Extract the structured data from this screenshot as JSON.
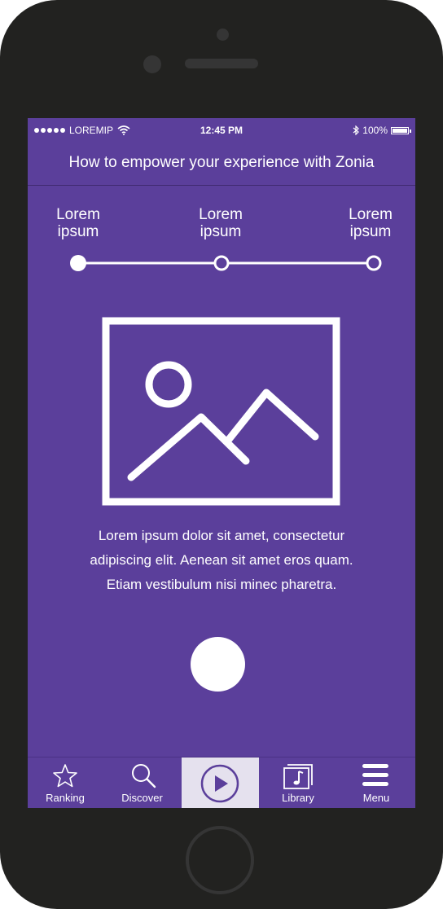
{
  "status_bar": {
    "carrier": "LOREMIP",
    "time": "12:45 PM",
    "battery": "100%"
  },
  "header": {
    "title": "How to empower your experience with Zonia"
  },
  "steps": [
    {
      "line1": "Lorem",
      "line2": "ipsum",
      "state": "active"
    },
    {
      "line1": "Lorem",
      "line2": "ipsum",
      "state": "inactive"
    },
    {
      "line1": "Lorem",
      "line2": "ipsum",
      "state": "inactive"
    }
  ],
  "illustration": {
    "icon": "image-placeholder-icon"
  },
  "content": {
    "line1": "Lorem ipsum dolor sit amet, consectetur",
    "line2": "adipiscing elit. Aenean sit amet eros quam.",
    "line3": "Etiam vestibulum nisi minec pharetra."
  },
  "tab_bar": {
    "tabs": [
      {
        "label": "Ranking",
        "icon": "star-icon"
      },
      {
        "label": "Discover",
        "icon": "search-icon"
      },
      {
        "label": "",
        "icon": "play-icon",
        "active": true
      },
      {
        "label": "Library",
        "icon": "music-library-icon"
      },
      {
        "label": "Menu",
        "icon": "hamburger-menu-icon"
      }
    ]
  },
  "colors": {
    "screen_bg": "#5b3f9b",
    "phone_body": "#222220",
    "active_tab_bg": "#e5e1ee"
  }
}
